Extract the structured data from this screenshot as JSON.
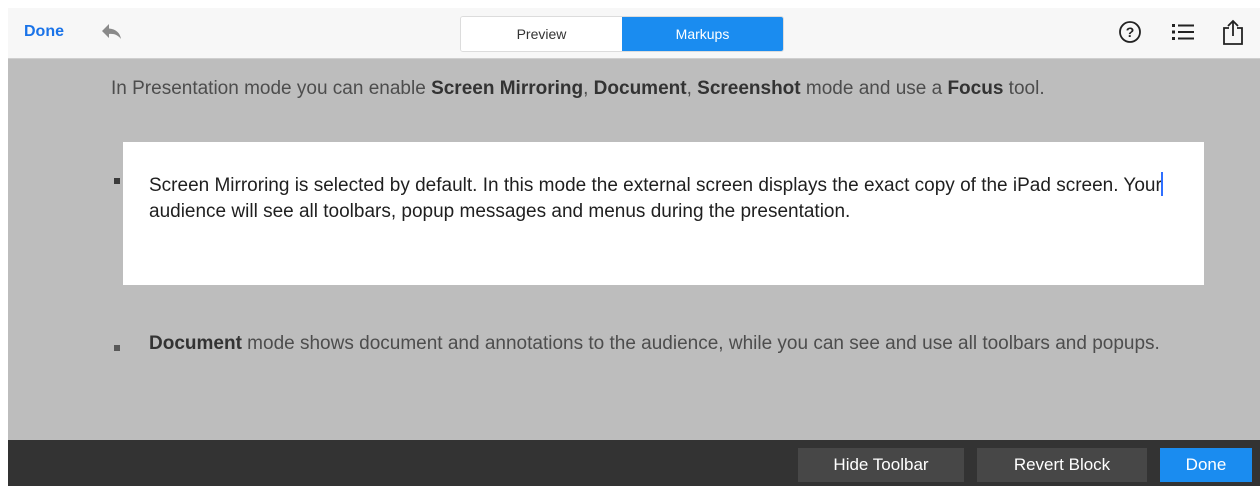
{
  "top_bar": {
    "done_label": "Done",
    "undo_icon": "undo-arrow-icon",
    "tabs": [
      {
        "label": "Preview",
        "selected": false
      },
      {
        "label": "Markups",
        "selected": true
      }
    ],
    "right_icons": [
      "help-icon",
      "list-icon",
      "share-icon"
    ]
  },
  "document": {
    "intro": {
      "t1": "In Presentation mode you can enable ",
      "b1": "Screen Mirroring",
      "t2": ", ",
      "b2": "Document",
      "t3": ", ",
      "b3": "Screenshot",
      "t4": " mode and use a ",
      "b4": "Focus",
      "t5": " tool."
    },
    "edit_block": {
      "before_cursor": "Screen Mirroring is selected by default. In this mode the external screen displays the exact copy of the iPad screen. Your",
      "after_cursor": " audience will see all toolbars, popup messages and menus during the presentation."
    },
    "bullet2": {
      "bold": "Document",
      "text": " mode shows document and annotations to the audience, while you can see and use all toolbars and popups."
    }
  },
  "bottom_bar": {
    "hide_toolbar_label": "Hide Toolbar",
    "revert_block_label": "Revert Block",
    "done_label": "Done"
  },
  "colors": {
    "accent": "#1a8cf0",
    "link": "#1a73e8",
    "content_bg": "#bdbdbd",
    "bottom_bar_bg": "#333333"
  }
}
